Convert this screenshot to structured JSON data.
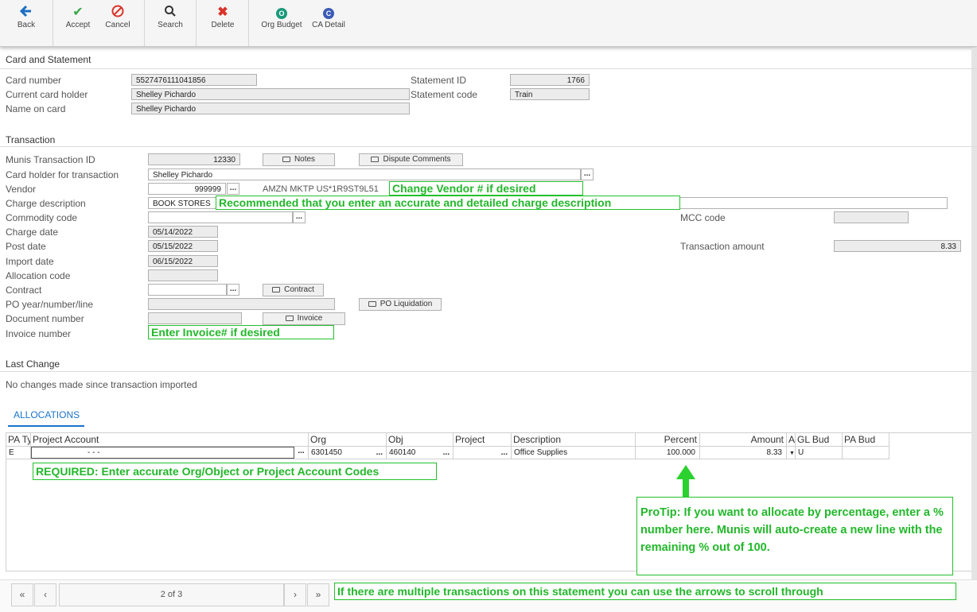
{
  "toolbar": {
    "back": "Back",
    "accept": "Accept",
    "cancel": "Cancel",
    "search": "Search",
    "delete": "Delete",
    "org_budget": "Org Budget",
    "org_budget_badge": "O",
    "ca_detail": "CA Detail",
    "ca_detail_badge": "C"
  },
  "card": {
    "section": "Card and Statement",
    "card_number_label": "Card number",
    "card_number": "5527476111041856",
    "holder_label": "Current card holder",
    "holder": "Shelley Pichardo",
    "name_label": "Name on card",
    "name": "Shelley Pichardo",
    "statement_id_label": "Statement ID",
    "statement_id": "1766",
    "statement_code_label": "Statement code",
    "statement_code": "Train"
  },
  "transaction": {
    "section": "Transaction",
    "munis_id_label": "Munis Transaction ID",
    "munis_id": "12330",
    "notes_btn": "Notes",
    "dispute_btn": "Dispute Comments",
    "txn_holder_label": "Card holder for transaction",
    "txn_holder": "Shelley Pichardo",
    "vendor_label": "Vendor",
    "vendor": "999999",
    "vendor_name": "AMZN MKTP US*1R9ST9L51",
    "charge_desc_label": "Charge description",
    "charge_desc": "BOOK STORES",
    "commodity_label": "Commodity code",
    "commodity": "",
    "mcc_label": "MCC code",
    "mcc": "",
    "charge_date_label": "Charge date",
    "charge_date": "05/14/2022",
    "post_date_label": "Post date",
    "post_date": "05/15/2022",
    "amount_label": "Transaction amount",
    "amount": "8.33",
    "import_date_label": "Import date",
    "import_date": "06/15/2022",
    "alloc_code_label": "Allocation code",
    "alloc_code": "",
    "contract_label": "Contract",
    "contract": "",
    "contract_btn": "Contract",
    "po_label": "PO year/number/line",
    "po": "",
    "po_btn": "PO Liquidation",
    "doc_label": "Document number",
    "doc": "",
    "invoice_btn": "Invoice",
    "invoice_label": "Invoice number"
  },
  "last_change": {
    "section": "Last Change",
    "text": "No changes made since transaction imported"
  },
  "allocations": {
    "tab": "ALLOCATIONS",
    "headers": [
      "PA Ty",
      "Project Account",
      "Org",
      "Obj",
      "Project",
      "Description",
      "Percent",
      "Amount",
      "A",
      "GL Bud",
      "PA Bud"
    ],
    "row": {
      "pa_type": "E",
      "project_account": "-               -               -",
      "org": "6301450",
      "obj": "460140",
      "project": "",
      "description": "Office Supplies",
      "percent": "100.000",
      "amount": "8.33",
      "gl_bud": "U",
      "pa_bud": ""
    }
  },
  "pager": {
    "position": "2 of 3"
  },
  "notes": {
    "vendor": "Change Vendor # if desired",
    "charge_desc": "Recommended that you enter an accurate  and detailed charge description",
    "invoice": "Enter Invoice# if desired",
    "required": "REQUIRED: Enter accurate Org/Object or Project Account Codes",
    "protip": "ProTip: If you want to allocate by percentage, enter a % number here. Munis will auto-create a new line with the remaining % out of 100.",
    "pager": "If there are multiple transactions on this statement you can use the arrows to scroll through"
  },
  "colors": {
    "note_green": "#22b82a",
    "tab_blue": "#1a73c8",
    "toolbar_bg": "#f5f5f5"
  }
}
